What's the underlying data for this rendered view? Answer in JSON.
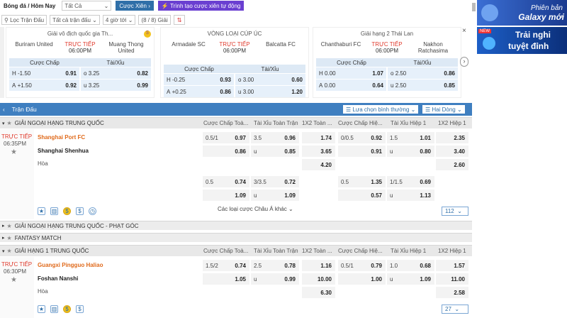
{
  "top": {
    "sport": "Bóng đá / Hôm Nay",
    "filter": "Tất Cả",
    "btn_parlay": "Cược Xiên",
    "btn_create": "Trình tạo cược xiên tự động"
  },
  "filterbar": {
    "league_filter": "Lọc Trận Đấu",
    "all_matches": "Tất cả trận đấu",
    "time": "4 giờ tới",
    "count": "(8 / 8) Giải"
  },
  "cards": [
    {
      "league": "Giải vô địch quốc gia Th...",
      "home": "Buriram United",
      "away": "Muang Thong United",
      "status": "TRỰC TIẾP",
      "time": "06:00PM",
      "h1": "Cược Chấp",
      "h2": "Tài/Xỉu",
      "r1": [
        "H",
        "-1.50",
        "0.91",
        "o",
        "3.25",
        "0.82"
      ],
      "r2": [
        "A",
        "+1.50",
        "0.92",
        "u",
        "3.25",
        "0.99"
      ]
    },
    {
      "league": "VÒNG LOẠI CÚP ÚC",
      "home": "Armadale SC",
      "away": "Balcatta FC",
      "status": "TRỰC TIẾP",
      "time": "06:00PM",
      "h1": "Cược Chấp",
      "h2": "Tài/Xỉu",
      "r1": [
        "H",
        "-0.25",
        "0.93",
        "o",
        "3.00",
        "0.60"
      ],
      "r2": [
        "A",
        "+0.25",
        "0.86",
        "u",
        "3.00",
        "1.20"
      ]
    },
    {
      "league": "Giải hạng 2 Thái Lan",
      "home": "Chanthaburi FC",
      "away": "Nakhon Ratchasima",
      "status": "TRỰC TIẾP",
      "time": "06:00PM",
      "h1": "Cược Chấp",
      "h2": "Tài/Xỉu",
      "r1": [
        "H",
        "0.00",
        "1.07",
        "o",
        "2.50",
        "0.86"
      ],
      "r2": [
        "A",
        "0.00",
        "0.64",
        "u",
        "2.50",
        "0.85"
      ]
    }
  ],
  "section": {
    "title": "Trận Đấu",
    "sort": "Lựa chọn bình thường",
    "odds": "Hai Dòng"
  },
  "cols": [
    "Cược Chấp Toà...",
    "Tài Xỉu Toàn Trận",
    "1X2 Toàn ...",
    "Cược Chấp Hiệ...",
    "Tài Xỉu Hiệp 1",
    "1X2 Hiệp 1"
  ],
  "league1": "GIẢI NGOẠI HẠNG TRUNG QUỐC",
  "m1": {
    "status": "TRỰC TIẾP",
    "time": "06:35PM",
    "home": "Shanghai Port FC",
    "away": "Shanghai Shenhua",
    "draw": "Hòa",
    "r1": [
      [
        "0.5/1",
        "0.97"
      ],
      [
        "3.5",
        "0.96"
      ],
      [
        "",
        "1.74"
      ],
      [
        "0/0.5",
        "0.92"
      ],
      [
        "1.5",
        "1.01"
      ],
      [
        "",
        "2.35"
      ]
    ],
    "r2": [
      [
        "",
        "0.86"
      ],
      [
        "u",
        "0.85"
      ],
      [
        "",
        "3.65"
      ],
      [
        "",
        "0.91"
      ],
      [
        "u",
        "0.80"
      ],
      [
        "",
        "3.40"
      ]
    ],
    "r3": [
      [
        "",
        ""
      ],
      [
        "",
        ""
      ],
      [
        "",
        "4.20"
      ],
      [
        "",
        ""
      ],
      [
        "",
        ""
      ],
      [
        "",
        "2.60"
      ]
    ],
    "r4": [
      [
        "0.5",
        "0.74"
      ],
      [
        "3/3.5",
        "0.72"
      ],
      [
        "",
        ""
      ],
      [
        "0.5",
        "1.35"
      ],
      [
        "1/1.5",
        "0.69"
      ],
      [
        "",
        ""
      ]
    ],
    "r5": [
      [
        "",
        "1.09"
      ],
      [
        "u",
        "1.09"
      ],
      [
        "",
        ""
      ],
      [
        "",
        "0.57"
      ],
      [
        "u",
        "1.13"
      ],
      [
        "",
        ""
      ]
    ],
    "more": "Các loại cược Châu Á khác",
    "count": "112"
  },
  "league2": "GIẢI NGOẠI HẠNG TRUNG QUỐC - PHẠT GÓC",
  "league3": "FANTASY MATCH",
  "league4": "GIẢI HẠNG 1 TRUNG QUỐC",
  "m2": {
    "status": "TRỰC TIẾP",
    "time": "06:30PM",
    "home": "Guangxi Pingguo Haliao",
    "away": "Foshan Nanshi",
    "draw": "Hòa",
    "r1": [
      [
        "1.5/2",
        "0.74"
      ],
      [
        "2.5",
        "0.78"
      ],
      [
        "",
        "1.16"
      ],
      [
        "0.5/1",
        "0.79"
      ],
      [
        "1.0",
        "0.68"
      ],
      [
        "",
        "1.57"
      ]
    ],
    "r2": [
      [
        "",
        "1.05"
      ],
      [
        "u",
        "0.99"
      ],
      [
        "",
        "10.00"
      ],
      [
        "",
        "1.00"
      ],
      [
        "u",
        "1.09"
      ],
      [
        "",
        "11.00"
      ]
    ],
    "r3": [
      [
        "",
        ""
      ],
      [
        "",
        ""
      ],
      [
        "",
        "6.30"
      ],
      [
        "",
        ""
      ],
      [
        "",
        ""
      ],
      [
        "",
        "2.58"
      ]
    ],
    "count": "27"
  },
  "ad1": {
    "l1": "Phiên bản",
    "l2": "Galaxy mới"
  },
  "ad2": {
    "badge": "NEW",
    "l1": "Trải nghi",
    "l2": "tuyệt đỉnh"
  }
}
